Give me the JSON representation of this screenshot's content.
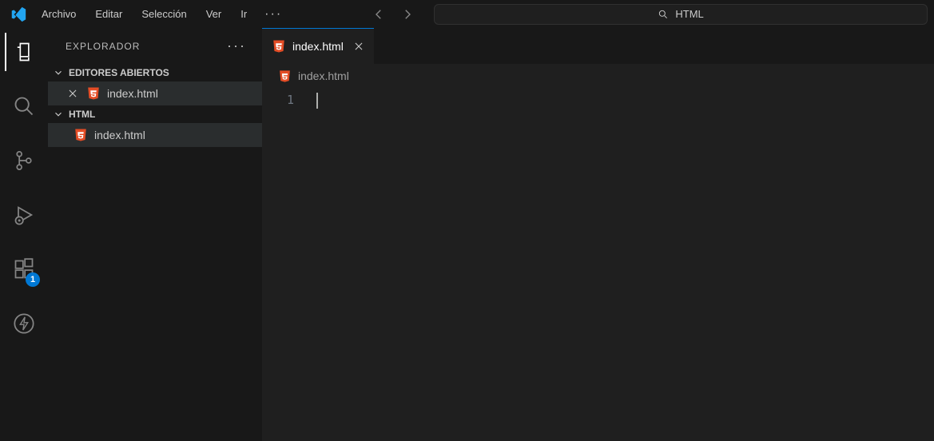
{
  "menu": {
    "items": [
      "Archivo",
      "Editar",
      "Selección",
      "Ver",
      "Ir"
    ],
    "overflow": "···"
  },
  "search": {
    "text": "HTML"
  },
  "sidebar": {
    "title": "EXPLORADOR",
    "sections": {
      "openEditors": {
        "label": "EDITORES ABIERTOS",
        "items": [
          {
            "name": "index.html",
            "modified": false
          }
        ]
      },
      "folder": {
        "label": "HTML",
        "items": [
          {
            "name": "index.html"
          }
        ]
      }
    }
  },
  "activity": {
    "extensionsBadge": "1"
  },
  "editor": {
    "tab": {
      "label": "index.html"
    },
    "breadcrumb": {
      "label": "index.html"
    },
    "gutter": {
      "line1": "1"
    }
  }
}
